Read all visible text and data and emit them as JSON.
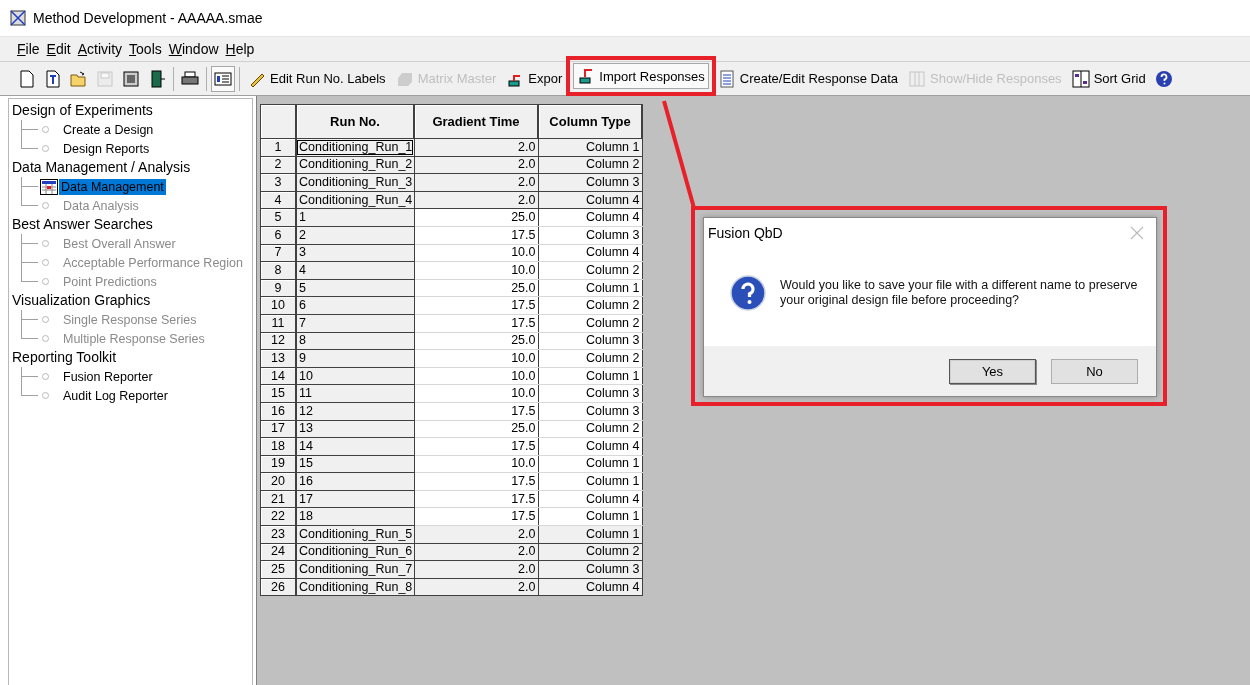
{
  "window": {
    "title": "Method Development - AAAAA.smae"
  },
  "menu": [
    "File",
    "Edit",
    "Activity",
    "Tools",
    "Window",
    "Help"
  ],
  "toolbar": [
    {
      "kind": "icon",
      "disabled": false,
      "pressed": false
    },
    {
      "kind": "icon",
      "disabled": false,
      "pressed": false
    },
    {
      "kind": "icon",
      "disabled": false,
      "pressed": false
    },
    {
      "kind": "icon",
      "disabled": true,
      "pressed": false
    },
    {
      "kind": "icon",
      "disabled": false,
      "pressed": false
    },
    {
      "kind": "icon",
      "disabled": false,
      "pressed": false
    },
    {
      "kind": "separator"
    },
    {
      "kind": "icon",
      "disabled": false,
      "pressed": false
    },
    {
      "kind": "separator"
    },
    {
      "kind": "icon",
      "disabled": false,
      "pressed": true
    },
    {
      "kind": "separator"
    },
    {
      "kind": "labeled",
      "label": "Edit Run No. Labels",
      "disabled": false,
      "pressed": false
    },
    {
      "kind": "labeled",
      "label": "Matrix Master",
      "disabled": true,
      "pressed": false
    },
    {
      "kind": "labeled",
      "label": "Expor",
      "disabled": false,
      "pressed": false
    },
    {
      "kind": "labeled",
      "label": "Import Responses",
      "disabled": false,
      "pressed": true
    },
    {
      "kind": "labeled",
      "label": "Create/Edit Response Data",
      "disabled": false,
      "pressed": false
    },
    {
      "kind": "labeled",
      "label": "Show/Hide Responses",
      "disabled": true,
      "pressed": false
    },
    {
      "kind": "labeled",
      "label": "Sort Grid",
      "disabled": false,
      "pressed": false
    },
    {
      "kind": "icon",
      "disabled": false,
      "pressed": false
    }
  ],
  "sidebar": {
    "groups": [
      {
        "label": "Design of Experiments",
        "children": [
          {
            "label": "Create a Design",
            "disabled": false,
            "selected": false
          },
          {
            "label": "Design Reports",
            "disabled": false,
            "selected": false
          }
        ]
      },
      {
        "label": "Data Management / Analysis",
        "children": [
          {
            "label": "Data Management",
            "disabled": false,
            "selected": true
          },
          {
            "label": "Data Analysis",
            "disabled": true,
            "selected": false
          }
        ]
      },
      {
        "label": "Best Answer Searches",
        "children": [
          {
            "label": "Best Overall Answer",
            "disabled": true,
            "selected": false
          },
          {
            "label": "Acceptable Performance Region",
            "disabled": true,
            "selected": false
          },
          {
            "label": "Point Predictions",
            "disabled": true,
            "selected": false
          }
        ]
      },
      {
        "label": "Visualization Graphics",
        "children": [
          {
            "label": "Single Response Series",
            "disabled": true,
            "selected": false
          },
          {
            "label": "Multiple Response Series",
            "disabled": true,
            "selected": false
          }
        ]
      },
      {
        "label": "Reporting Toolkit",
        "children": [
          {
            "label": "Fusion Reporter",
            "disabled": false,
            "selected": false
          },
          {
            "label": "Audit Log Reporter",
            "disabled": false,
            "selected": false
          }
        ]
      }
    ]
  },
  "table": {
    "columns": [
      "Run No.",
      "Gradient Time",
      "Column Type"
    ],
    "rows": [
      {
        "num": "1",
        "run": "Conditioning_Run_1",
        "time": "2.0",
        "column": "Column 1",
        "shaded": true,
        "focused": true
      },
      {
        "num": "2",
        "run": "Conditioning_Run_2",
        "time": "2.0",
        "column": "Column 2",
        "shaded": true,
        "focused": false
      },
      {
        "num": "3",
        "run": "Conditioning_Run_3",
        "time": "2.0",
        "column": "Column 3",
        "shaded": true,
        "focused": false
      },
      {
        "num": "4",
        "run": "Conditioning_Run_4",
        "time": "2.0",
        "column": "Column 4",
        "shaded": true,
        "focused": false
      },
      {
        "num": "5",
        "run": "1",
        "time": "25.0",
        "column": "Column 4",
        "shaded": false,
        "focused": false
      },
      {
        "num": "6",
        "run": "2",
        "time": "17.5",
        "column": "Column 3",
        "shaded": false,
        "focused": false
      },
      {
        "num": "7",
        "run": "3",
        "time": "10.0",
        "column": "Column 4",
        "shaded": false,
        "focused": false
      },
      {
        "num": "8",
        "run": "4",
        "time": "10.0",
        "column": "Column 2",
        "shaded": false,
        "focused": false
      },
      {
        "num": "9",
        "run": "5",
        "time": "25.0",
        "column": "Column 1",
        "shaded": false,
        "focused": false
      },
      {
        "num": "10",
        "run": "6",
        "time": "17.5",
        "column": "Column 2",
        "shaded": false,
        "focused": false
      },
      {
        "num": "11",
        "run": "7",
        "time": "17.5",
        "column": "Column 2",
        "shaded": false,
        "focused": false
      },
      {
        "num": "12",
        "run": "8",
        "time": "25.0",
        "column": "Column 3",
        "shaded": false,
        "focused": false
      },
      {
        "num": "13",
        "run": "9",
        "time": "10.0",
        "column": "Column 2",
        "shaded": false,
        "focused": false
      },
      {
        "num": "14",
        "run": "10",
        "time": "10.0",
        "column": "Column 1",
        "shaded": false,
        "focused": false
      },
      {
        "num": "15",
        "run": "11",
        "time": "10.0",
        "column": "Column 3",
        "shaded": false,
        "focused": false
      },
      {
        "num": "16",
        "run": "12",
        "time": "17.5",
        "column": "Column 3",
        "shaded": false,
        "focused": false
      },
      {
        "num": "17",
        "run": "13",
        "time": "25.0",
        "column": "Column 2",
        "shaded": false,
        "focused": false
      },
      {
        "num": "18",
        "run": "14",
        "time": "17.5",
        "column": "Column 4",
        "shaded": false,
        "focused": false
      },
      {
        "num": "19",
        "run": "15",
        "time": "10.0",
        "column": "Column 1",
        "shaded": false,
        "focused": false
      },
      {
        "num": "20",
        "run": "16",
        "time": "17.5",
        "column": "Column 1",
        "shaded": false,
        "focused": false
      },
      {
        "num": "21",
        "run": "17",
        "time": "17.5",
        "column": "Column 4",
        "shaded": false,
        "focused": false
      },
      {
        "num": "22",
        "run": "18",
        "time": "17.5",
        "column": "Column 1",
        "shaded": false,
        "focused": false
      },
      {
        "num": "23",
        "run": "Conditioning_Run_5",
        "time": "2.0",
        "column": "Column 1",
        "shaded": true,
        "focused": false
      },
      {
        "num": "24",
        "run": "Conditioning_Run_6",
        "time": "2.0",
        "column": "Column 2",
        "shaded": true,
        "focused": false
      },
      {
        "num": "25",
        "run": "Conditioning_Run_7",
        "time": "2.0",
        "column": "Column 3",
        "shaded": true,
        "focused": false
      },
      {
        "num": "26",
        "run": "Conditioning_Run_8",
        "time": "2.0",
        "column": "Column 4",
        "shaded": true,
        "focused": false
      }
    ]
  },
  "dialog": {
    "title": "Fusion QbD",
    "message": "Would you like to save your file with a different name to preserve your original design file before proceeding?",
    "buttons": [
      {
        "label": "Yes",
        "default": true
      },
      {
        "label": "No",
        "default": false
      }
    ]
  }
}
